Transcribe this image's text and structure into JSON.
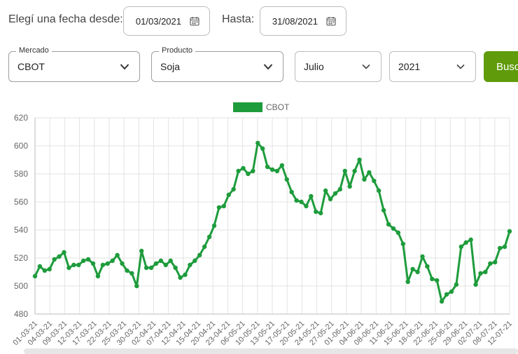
{
  "filters": {
    "from_label": "Elegí una fecha desde:",
    "from_date": "01/03/2021",
    "to_label": "Hasta:",
    "to_date": "31/08/2021"
  },
  "selects": {
    "mercado": {
      "label": "Mercado",
      "value": "CBOT"
    },
    "producto": {
      "label": "Producto",
      "value": "Soja"
    },
    "mes": {
      "value": "Julio"
    },
    "anio": {
      "value": "2021"
    }
  },
  "search_button": {
    "label": "Busc"
  },
  "colors": {
    "accent": "#5f9b0a",
    "series": "#1e9c3c",
    "grid": "#e3e3e3"
  },
  "chart_data": {
    "type": "line",
    "title": "",
    "xlabel": "",
    "ylabel": "",
    "legend": "top-center",
    "grid": true,
    "ylim": [
      480,
      620
    ],
    "yticks": [
      480,
      500,
      520,
      540,
      560,
      580,
      600,
      620
    ],
    "tick_labels": [
      "01-03-21",
      "04-03-21",
      "09-03-21",
      "12-03-21",
      "17-03-21",
      "22-03-21",
      "25-03-21",
      "30-03-21",
      "02-04-21",
      "07-04-21",
      "12-04-21",
      "15-04-21",
      "20-04-21",
      "23-04-21",
      "06-05-21",
      "10-05-21",
      "13-05-21",
      "17-05-21",
      "20-05-21",
      "24-05-21",
      "27-05-21",
      "01-06-21",
      "04-06-21",
      "08-06-21",
      "11-06-21",
      "15-06-21",
      "18-06-21",
      "22-06-21",
      "25-06-21",
      "29-06-21",
      "02-07-21",
      "08-07-21",
      "12-07-21"
    ],
    "series": [
      {
        "name": "CBOT",
        "values": [
          507,
          514,
          511,
          512,
          519,
          521,
          524,
          513,
          515,
          515,
          518,
          519,
          516,
          507,
          515,
          516,
          518,
          522,
          516,
          511,
          509,
          500,
          525,
          513,
          513,
          516,
          518,
          515,
          518,
          513,
          506,
          508,
          515,
          518,
          522,
          528,
          535,
          543,
          556,
          557,
          565,
          569,
          582,
          584,
          580,
          582,
          602,
          598,
          585,
          583,
          582,
          586,
          576,
          567,
          561,
          560,
          557,
          564,
          553,
          552,
          568,
          562,
          566,
          569,
          582,
          571,
          582,
          590,
          576,
          581,
          575,
          568,
          554,
          544,
          541,
          538,
          530,
          503,
          512,
          510,
          521,
          514,
          505,
          504,
          489,
          494,
          496,
          501,
          528,
          531,
          533,
          501,
          509,
          510,
          516,
          517,
          527,
          528,
          539
        ]
      }
    ]
  }
}
